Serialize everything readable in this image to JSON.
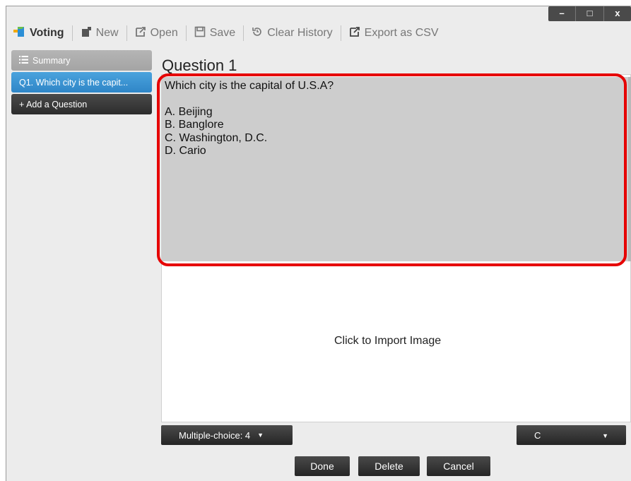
{
  "window_controls": {
    "minimize": "–",
    "maximize": "□",
    "close": "x"
  },
  "toolbar": {
    "app_name": "Voting",
    "new_label": "New",
    "open_label": "Open",
    "save_label": "Save",
    "clear_history_label": "Clear History",
    "export_label": "Export as CSV"
  },
  "sidebar": {
    "items": [
      {
        "label": "Summary",
        "icon": "list-icon"
      },
      {
        "label": "Q1. Which city is the capit..."
      },
      {
        "label": "+ Add a Question"
      }
    ]
  },
  "question": {
    "title": "Question 1",
    "text": "Which city is the capital of U.S.A?\n\nA. Beijing\nB. Banglore\nC. Washington, D.C.\nD. Cario",
    "import_image_label": "Click to Import Image"
  },
  "controls": {
    "type_select": "Multiple-choice: 4",
    "answer_select": "C",
    "done_label": "Done",
    "delete_label": "Delete",
    "cancel_label": "Cancel"
  },
  "colors": {
    "highlight": "#e60000",
    "selected_item": "#2f86c7",
    "question_bg": "#cdcdcd"
  }
}
